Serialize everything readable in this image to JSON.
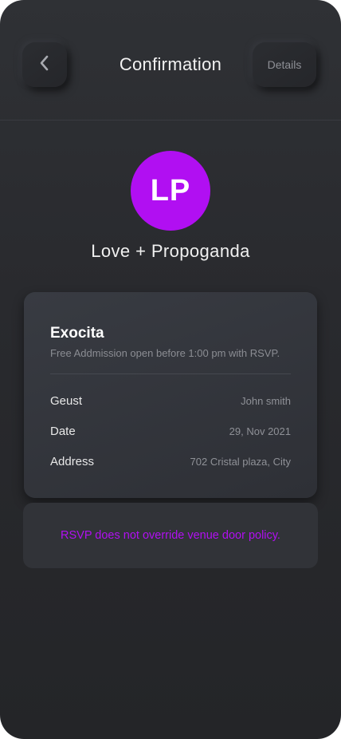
{
  "header": {
    "title": "Confirmation",
    "back_icon": "chevron-left-icon",
    "details_label": "Details"
  },
  "artist": {
    "initials": "LP",
    "name": "Love + Propoganda",
    "avatar_color": "#b10ff2"
  },
  "event": {
    "name": "Exocita",
    "subtitle": "Free Addmission open before 1:00 pm with RSVP.",
    "rows": [
      {
        "label": "Geust",
        "value": "John smith"
      },
      {
        "label": "Date",
        "value": "29, Nov 2021"
      },
      {
        "label": "Address",
        "value": "702 Cristal plaza, City"
      }
    ]
  },
  "notice": {
    "text": "RSVP does not override venue door policy.",
    "color": "#b10ff2"
  }
}
